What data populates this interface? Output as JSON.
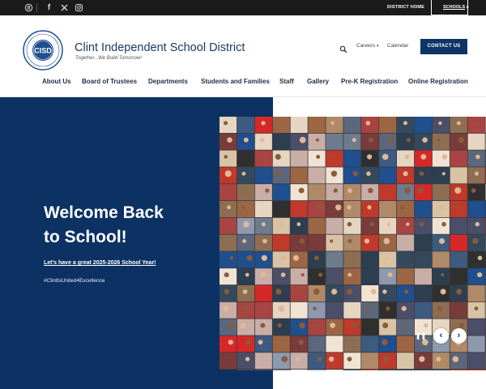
{
  "topbar": {
    "social": [
      {
        "icon": "translate-icon",
        "glyph": "⚙"
      },
      {
        "icon": "facebook-icon",
        "glyph": "f"
      },
      {
        "icon": "x-twitter-icon",
        "glyph": "✕"
      },
      {
        "icon": "instagram-icon",
        "glyph": "◎"
      }
    ],
    "district_home": "DISTRICT HOME",
    "schools": "SCHOOLS"
  },
  "header": {
    "logo_text": "CISD",
    "logo_ring_text": "Clint Independent School District",
    "school_name": "Clint Independent School District",
    "tagline": "Together...We Build Tomorrow!",
    "careers": "Careers",
    "calendar": "Calendar",
    "contact": "CONTACT US"
  },
  "nav": [
    "About Us",
    "Board of Trustees",
    "Departments",
    "Students and Families",
    "Staff",
    "Gallery",
    "Pre-K Registration",
    "Online Registration"
  ],
  "hero": {
    "title_line1": "Welcome Back",
    "title_line2": "to School!",
    "link": "Let's have a great 2025-2026 School Year!",
    "hashtag": "#ClintIsUnited4Excellence"
  },
  "colors": {
    "navy": "#0c3264",
    "topbar": "#1b1b1b",
    "button": "#0f3466"
  }
}
